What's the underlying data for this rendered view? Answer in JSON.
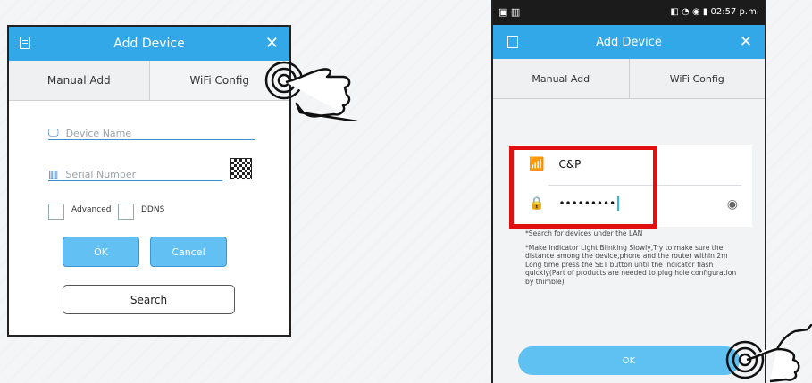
{
  "left_dialog": {
    "title": "Add Device",
    "tabs": [
      "Manual Add",
      "WiFi Config"
    ],
    "device_name_placeholder": "Device Name",
    "serial_placeholder": "Serial Number",
    "advanced_label": "Advanced",
    "ddns_label": "DDNS",
    "ok_label": "OK",
    "cancel_label": "Cancel",
    "search_label": "Search"
  },
  "phone": {
    "status": {
      "time": "02:57 p.m."
    },
    "title": "Add Device",
    "tabs": [
      "Manual Add",
      "WiFi Config"
    ],
    "ssid": "C&P",
    "password_mask": "•••••••••",
    "info_lines": [
      "*Search for devices under the LAN",
      "*Make Indicator Light Blinking Slowly,Try to make sure the distance among the device,phone and the router within 2m Long time press the SET button until the indicator flash quickly(Part of products are needed to plug hole configuration by thimble)"
    ],
    "ok_label": "OK"
  },
  "accent": "#33a8e8",
  "highlight": "#e01010"
}
